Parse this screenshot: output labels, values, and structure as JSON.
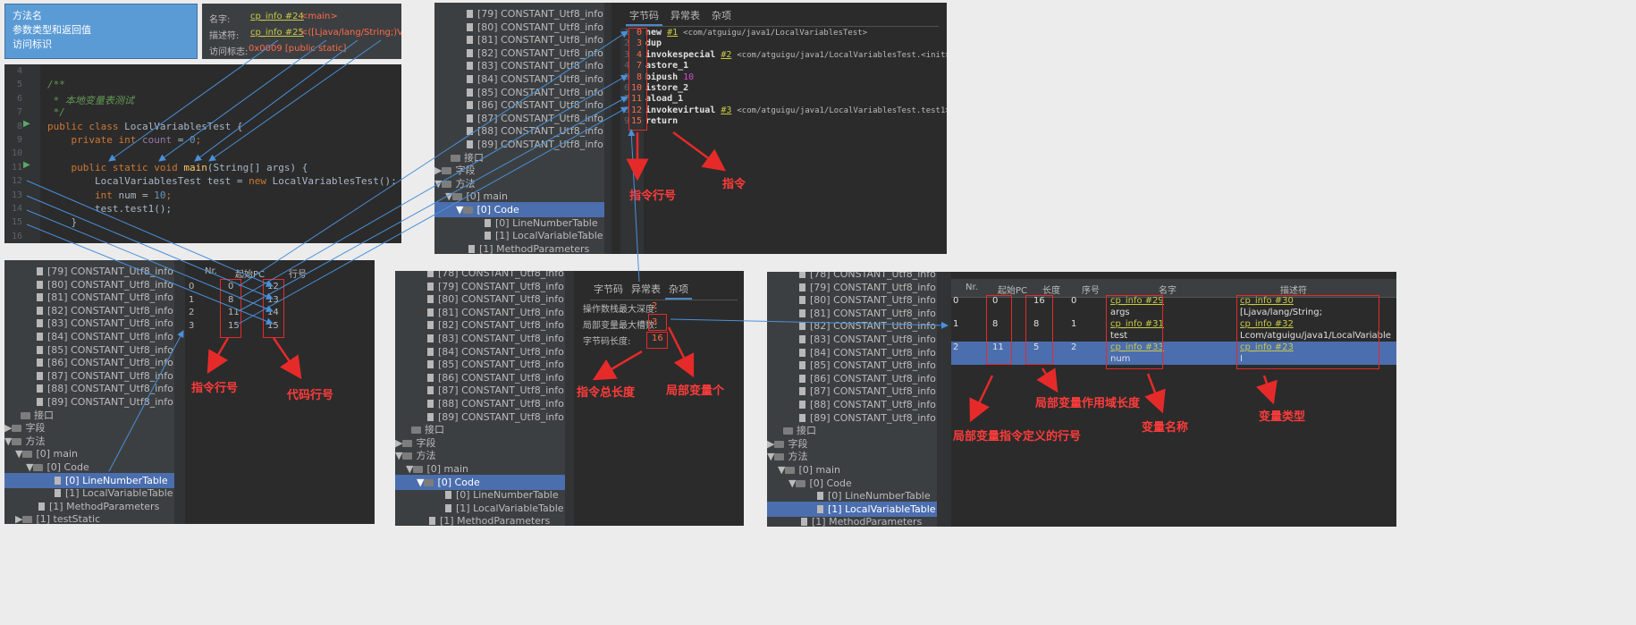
{
  "info_box": {
    "lines": [
      "方法名",
      "参数类型和返回值",
      "访问标识"
    ]
  },
  "method_info": {
    "name_label": "名字:",
    "name_ref": "cp_info #24",
    "name_val": "<main>",
    "desc_label": "描述符:",
    "desc_ref": "cp_info #25",
    "desc_val": "<([Ljava/lang/String;)V>",
    "access_label": "访问标志:",
    "access_val": "0x0009 [public static]"
  },
  "code": {
    "line_numbers": [
      "4",
      "5",
      "6",
      "7",
      "8",
      "9",
      "10",
      "11",
      "12",
      "13",
      "14",
      "15",
      "16"
    ],
    "lines": [
      [],
      [
        {
          "t": "/**",
          "c": "#629755"
        }
      ],
      [
        {
          "t": " * 本地变量表测试",
          "c": "#629755"
        }
      ],
      [
        {
          "t": " */",
          "c": "#629755"
        }
      ],
      [
        {
          "t": "public class ",
          "c": "#cc7832"
        },
        {
          "t": "LocalVariablesTest {",
          "c": "#a9b7c6"
        }
      ],
      [
        {
          "t": "    private int ",
          "c": "#cc7832"
        },
        {
          "t": "count",
          "c": "#9876aa"
        },
        {
          "t": " = ",
          "c": "#a9b7c6"
        },
        {
          "t": "0",
          "c": "#6897bb"
        },
        {
          "t": ";",
          "c": "#cc7832"
        }
      ],
      [],
      [
        {
          "t": "    public static void ",
          "c": "#cc7832"
        },
        {
          "t": "main",
          "c": "#ffc66d"
        },
        {
          "t": "(String[] args) {",
          "c": "#a9b7c6"
        }
      ],
      [
        {
          "t": "        LocalVariablesTest test = ",
          "c": "#a9b7c6"
        },
        {
          "t": "new ",
          "c": "#cc7832"
        },
        {
          "t": "LocalVariablesTest();",
          "c": "#a9b7c6"
        }
      ],
      [
        {
          "t": "        int ",
          "c": "#cc7832"
        },
        {
          "t": "num = ",
          "c": "#a9b7c6"
        },
        {
          "t": "10",
          "c": "#6897bb"
        },
        {
          "t": ";",
          "c": "#cc7832"
        }
      ],
      [
        {
          "t": "        test.test1();",
          "c": "#a9b7c6"
        }
      ],
      [
        {
          "t": "    }",
          "c": "#a9b7c6"
        }
      ],
      []
    ]
  },
  "constants": [
    "[79] CONSTANT_Utf8_info",
    "[80] CONSTANT_Utf8_info",
    "[81] CONSTANT_Utf8_info",
    "[82] CONSTANT_Utf8_info",
    "[83] CONSTANT_Utf8_info",
    "[84] CONSTANT_Utf8_info",
    "[85] CONSTANT_Utf8_info",
    "[86] CONSTANT_Utf8_info",
    "[87] CONSTANT_Utf8_info",
    "[88] CONSTANT_Utf8_info",
    "[89] CONSTANT_Utf8_info"
  ],
  "tree_labels": {
    "interfaces": "接口",
    "fields": "字段",
    "methods": "方法",
    "main": "[0] main",
    "code": "[0] Code",
    "lnt": "[0] LineNumberTable",
    "lvt": "[1] LocalVariableTable",
    "params": "[1] MethodParameters",
    "test_static": "[1] testStatic",
    "partial": "[78] CONSTANT_Utf8_info"
  },
  "tabs": {
    "bytecode": "字节码",
    "exceptions": "异常表",
    "misc": "杂项"
  },
  "bytecode": {
    "rows": [
      {
        "ln": "1",
        "pc": "0",
        "op": "new",
        "ref": "#1",
        "arg": "<com/atguigu/java1/LocalVariablesTest>"
      },
      {
        "ln": "2",
        "pc": "3",
        "op": "dup",
        "ref": "",
        "arg": ""
      },
      {
        "ln": "3",
        "pc": "4",
        "op": "invokespecial",
        "ref": "#2",
        "arg": "<com/atguigu/java1/LocalVariablesTest.<init>>"
      },
      {
        "ln": "4",
        "pc": "7",
        "op": "astore_1",
        "ref": "",
        "arg": ""
      },
      {
        "ln": "5",
        "pc": "8",
        "op": "bipush",
        "ref": "",
        "arg": "",
        "num": "10"
      },
      {
        "ln": "6",
        "pc": "10",
        "op": "istore_2",
        "ref": "",
        "arg": ""
      },
      {
        "ln": "7",
        "pc": "11",
        "op": "aload_1",
        "ref": "",
        "arg": ""
      },
      {
        "ln": "8",
        "pc": "12",
        "op": "invokevirtual",
        "ref": "#3",
        "arg": "<com/atguigu/java1/LocalVariablesTest.test1>"
      },
      {
        "ln": "9",
        "pc": "15",
        "op": "return",
        "ref": "",
        "arg": ""
      }
    ]
  },
  "line_table": {
    "headers": [
      "Nr.",
      "起始PC",
      "行号"
    ],
    "rows": [
      [
        "0",
        "0",
        "12"
      ],
      [
        "1",
        "8",
        "13"
      ],
      [
        "2",
        "11",
        "14"
      ],
      [
        "3",
        "15",
        "15"
      ]
    ]
  },
  "misc": {
    "stack_label": "操作数栈最大深度:",
    "stack_val": "2",
    "locals_label": "局部变量最大槽数:",
    "locals_val": "3",
    "codelen_label": "字节码长度:",
    "codelen_val": "16"
  },
  "lvt": {
    "headers": [
      "Nr.",
      "起始PC",
      "长度",
      "序号",
      "名字",
      "描述符"
    ],
    "rows": [
      {
        "nr": "0",
        "pc": "0",
        "len": "16",
        "idx": "0",
        "name_ref": "cp_info #29",
        "name": "args",
        "desc_ref": "cp_info #30",
        "desc": "[Ljava/lang/String;"
      },
      {
        "nr": "1",
        "pc": "8",
        "len": "8",
        "idx": "1",
        "name_ref": "cp_info #31",
        "name": "test",
        "desc_ref": "cp_info #32",
        "desc": "Lcom/atguigu/java1/LocalVariable"
      },
      {
        "nr": "2",
        "pc": "11",
        "len": "5",
        "idx": "2",
        "name_ref": "cp_info #33",
        "name": "num",
        "desc_ref": "cp_info #23",
        "desc": "I"
      }
    ]
  },
  "annotations": {
    "instr_line": "指令行号",
    "instr": "指令",
    "instr_line2": "指令行号",
    "code_line": "代码行号",
    "total_len": "指令总长度",
    "local_count": "局部变量个",
    "def_line": "局部变量指令定义的行号",
    "scope_len": "局部变量作用域长度",
    "var_name": "变量名称",
    "var_type": "变量类型"
  },
  "colors": {
    "accent": "#4b6eaf",
    "annotation": "#e62a2a",
    "arrow_blue": "#4a90d9",
    "info_box": "#5b9bd5"
  }
}
